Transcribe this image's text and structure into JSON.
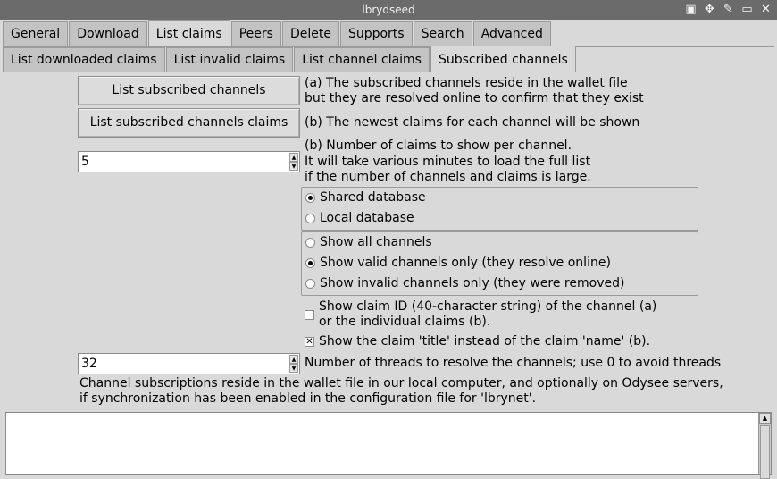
{
  "window": {
    "title": "lbrydseed",
    "controls": [
      "display-icon",
      "move-icon",
      "pin-icon",
      "maximize-icon",
      "close-icon"
    ]
  },
  "main_tabs": [
    "General",
    "Download",
    "List claims",
    "Peers",
    "Delete",
    "Supports",
    "Search",
    "Advanced"
  ],
  "main_tabs_active": "List claims",
  "sub_tabs": [
    "List downloaded claims",
    "List invalid claims",
    "List channel claims",
    "Subscribed channels"
  ],
  "sub_tabs_active": "Subscribed channels",
  "content": {
    "btn_list_subscribed": "List subscribed channels",
    "desc_a_line1": "(a) The subscribed channels reside in the wallet file",
    "desc_a_line2": "but they are resolved online to confirm that they exist",
    "btn_list_claims": "List subscribed channels claims",
    "desc_b": "(b) The newest claims for each channel will be shown",
    "claims_per_channel_value": "5",
    "claims_desc_line1": "(b) Number of claims to show per channel.",
    "claims_desc_line2": "It will take various minutes to load the full list",
    "claims_desc_line3": "if the number of channels and claims is large.",
    "db_options": [
      {
        "label": "Shared database",
        "selected": true
      },
      {
        "label": "Local database",
        "selected": false
      }
    ],
    "channel_options": [
      {
        "label": "Show all channels",
        "selected": false
      },
      {
        "label": "Show valid channels only (they resolve online)",
        "selected": true
      },
      {
        "label": "Show invalid channels only (they were removed)",
        "selected": false
      }
    ],
    "check_claim_id_line1": "Show claim ID (40-character string) of the channel (a)",
    "check_claim_id_line2": "or the individual claims (b).",
    "check_claim_id_checked": false,
    "check_title": "Show the claim 'title' instead of the claim 'name' (b).",
    "check_title_checked": true,
    "threads_value": "32",
    "threads_desc": "Number of threads to resolve the channels; use 0 to avoid threads",
    "info_line1": "Channel subscriptions reside in the wallet file in our local computer, and optionally on Odysee servers,",
    "info_line2": "if synchronization has been enabled in the configuration file for 'lbrynet'."
  }
}
